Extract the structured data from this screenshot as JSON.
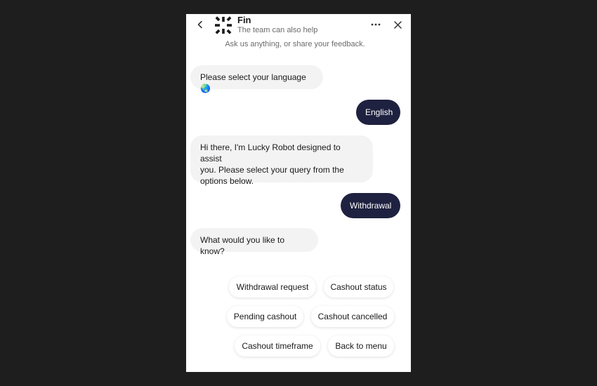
{
  "header": {
    "title": "Fin",
    "subtitle": "The team can also help",
    "intro": "Ask us anything, or share your feedback."
  },
  "messages": [
    {
      "sender": "bot",
      "text": "Please select your language",
      "emoji": "🌏"
    },
    {
      "sender": "user",
      "text": "English"
    },
    {
      "sender": "bot",
      "lines": [
        "Hi there, I'm Lucky Robot designed to assist",
        "you. Please select your query from the",
        "options below."
      ]
    },
    {
      "sender": "user",
      "text": "Withdrawal"
    },
    {
      "sender": "bot",
      "text": "What would you like to know?"
    }
  ],
  "quick_replies": [
    "Withdrawal request",
    "Cashout status",
    "Pending cashout",
    "Cashout cancelled",
    "Cashout timeframe",
    "Back to menu"
  ],
  "colors": {
    "background": "#1e1e1e",
    "panel": "#ffffff",
    "user_bubble": "#1f2140",
    "bot_bubble": "#f3f3f4"
  },
  "icons": {
    "back": "chevron-left-icon",
    "logo": "fin-logo",
    "more": "more-horizontal-icon",
    "close": "close-icon"
  }
}
